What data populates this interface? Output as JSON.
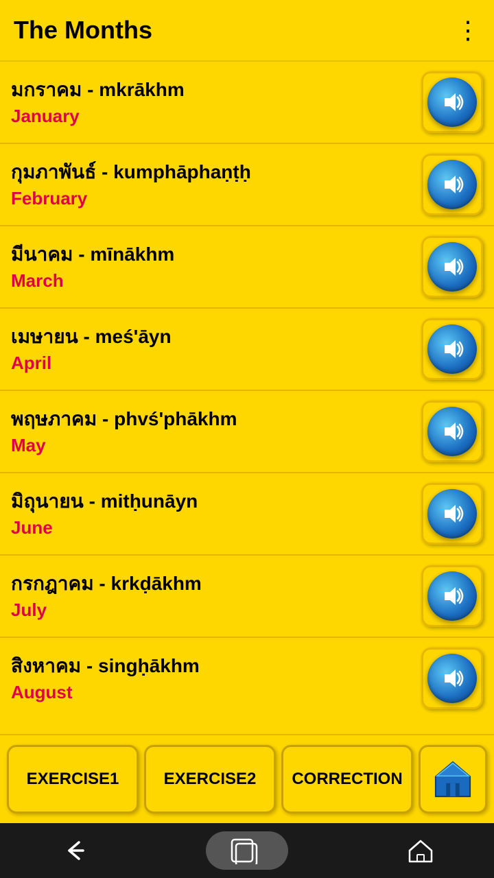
{
  "header": {
    "title": "The Months",
    "menu_icon": "⋮"
  },
  "months": [
    {
      "thai": "มกราคม - mkrākhm",
      "english": "January"
    },
    {
      "thai": "กุมภาพันธ์ - kumphāphaṇṭḥ",
      "english": "February"
    },
    {
      "thai": "มีนาคม - mīnākhm",
      "english": "March"
    },
    {
      "thai": "เมษายน - meś'āyn",
      "english": "April"
    },
    {
      "thai": "พฤษภาคม - phvś'phākhm",
      "english": "May"
    },
    {
      "thai": "มิถุนายน - mitḥunāyn",
      "english": "June"
    },
    {
      "thai": "กรกฎาคม - krkḍākhm",
      "english": "July"
    },
    {
      "thai": "สิงหาคม - singḥākhm",
      "english": "August"
    }
  ],
  "buttons": {
    "exercise1": "EXERCISE1",
    "exercise2": "EXERCISE2",
    "correction": "CORRECTION"
  },
  "colors": {
    "background": "#FFD700",
    "text_main": "#000000",
    "text_month": "#e0004a",
    "audio_blue": "#1a6bbf"
  }
}
